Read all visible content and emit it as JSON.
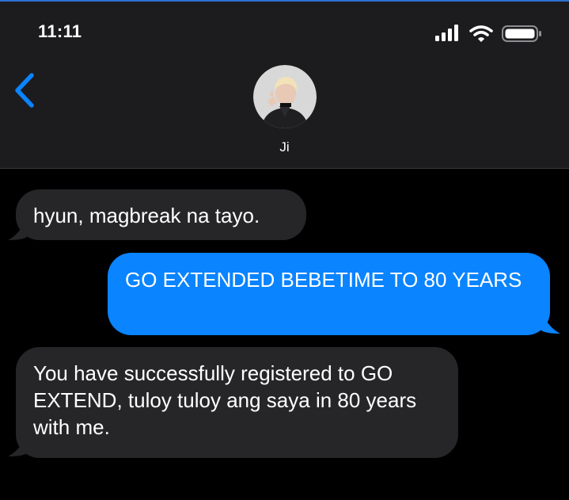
{
  "status_bar": {
    "time": "11:11",
    "signal_icon": "cellular-signal-icon",
    "wifi_icon": "wifi-icon",
    "battery_icon": "battery-icon"
  },
  "header": {
    "back_icon": "chevron-left-icon",
    "contact_name": "Ji",
    "avatar": "contact-avatar-photo"
  },
  "colors": {
    "accent": "#0a84ff",
    "received_bubble": "#262629",
    "header_background": "#1c1c1e",
    "background": "#000000"
  },
  "messages": [
    {
      "direction": "received",
      "text": "hyun, magbreak na tayo."
    },
    {
      "direction": "sent",
      "text": "GO EXTENDED BEBETIME TO 80 YEARS"
    },
    {
      "direction": "received",
      "text": "You have successfully registered to GO EXTEND, tuloy tuloy ang saya in 80 years with me."
    }
  ]
}
